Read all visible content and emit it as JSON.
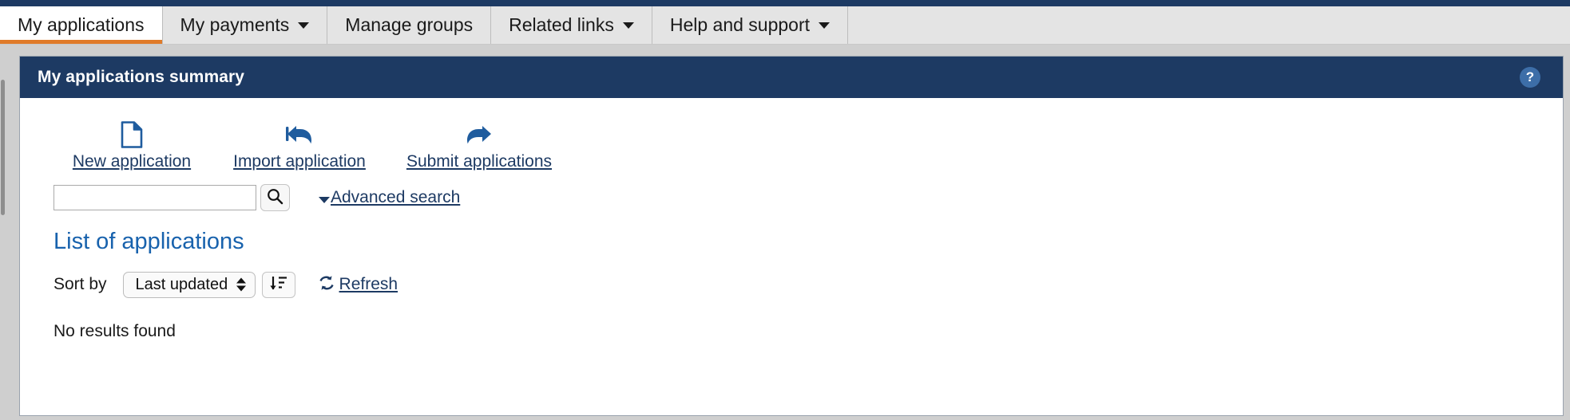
{
  "nav": {
    "items": [
      {
        "label": "My applications",
        "has_caret": false,
        "active": true
      },
      {
        "label": "My payments",
        "has_caret": true,
        "active": false
      },
      {
        "label": "Manage groups",
        "has_caret": false,
        "active": false
      },
      {
        "label": "Related links",
        "has_caret": true,
        "active": false
      },
      {
        "label": "Help and support",
        "has_caret": true,
        "active": false
      }
    ]
  },
  "panel": {
    "title": "My applications summary",
    "help_icon": "?",
    "header_color": "#1d3a63"
  },
  "actions": [
    {
      "label": "New application",
      "icon": "document-page-icon"
    },
    {
      "label": "Import application",
      "icon": "reply-arrow-icon"
    },
    {
      "label": "Submit applications",
      "icon": "forward-arrow-icon"
    }
  ],
  "search": {
    "value": "",
    "placeholder": "",
    "button_icon": "search-icon",
    "advanced_label": "Advanced search",
    "advanced_caret": "chevron-down-icon"
  },
  "list": {
    "title": "List of applications",
    "sort_label": "Sort by",
    "sort_value": "Last updated",
    "sort_options": [
      "Last updated"
    ],
    "sort_direction_icon": "sort-descending-icon",
    "refresh_label": "Refresh",
    "refresh_icon": "refresh-icon",
    "empty_message": "No results found"
  },
  "colors": {
    "brand_dark_blue": "#1d3a63",
    "link_blue": "#1d3a63",
    "heading_blue": "#1862ad",
    "active_tab_underline": "#e07b2a",
    "icon_blue": "#1f5c9e"
  }
}
